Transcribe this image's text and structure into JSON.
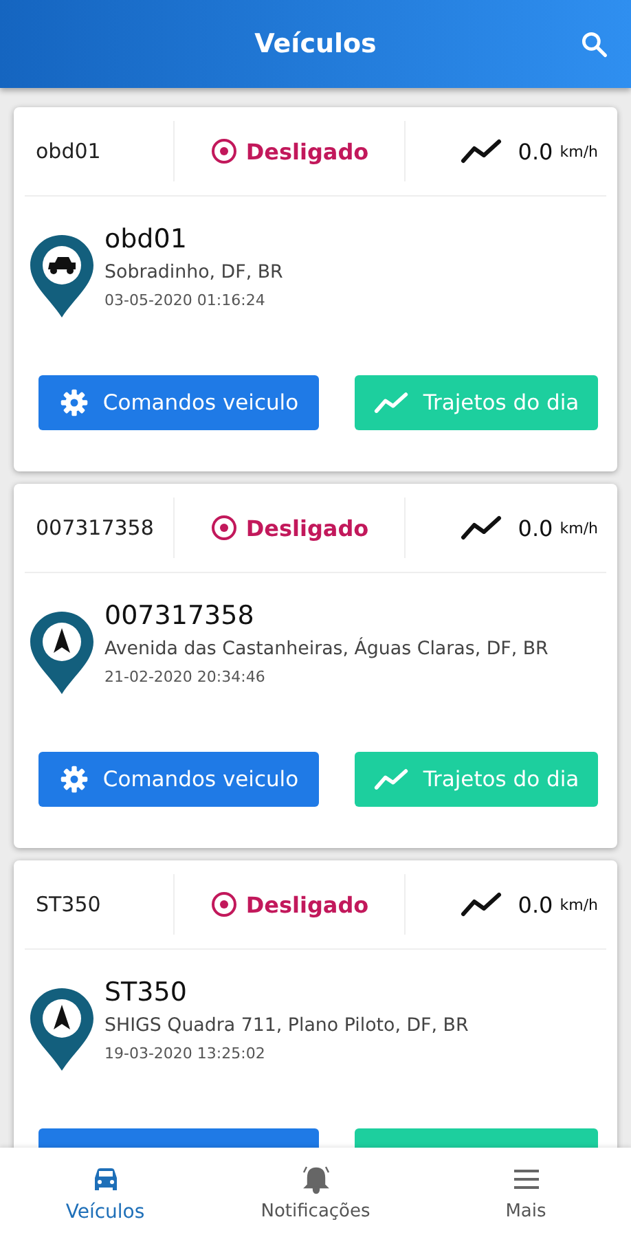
{
  "header": {
    "title": "Veículos"
  },
  "vehicles": [
    {
      "id": "obd01",
      "online": false,
      "status": "Desligado",
      "speed": "0.0",
      "unit": "km/h",
      "kind": "car",
      "name": "obd01",
      "address": "Sobradinho, DF, BR",
      "time": "03-05-2020 01:16:24",
      "buttons": [
        {
          "kind": "commands",
          "label": "Comandos veiculo"
        },
        {
          "kind": "routes",
          "label": "Trajetos do dia"
        }
      ]
    },
    {
      "id": "007317358",
      "online": false,
      "status": "Desligado",
      "speed": "0.0",
      "unit": "km/h",
      "kind": "arrow",
      "name": "007317358",
      "address": "Avenida das Castanheiras, Águas Claras, DF, BR",
      "time": "21-02-2020 20:34:46",
      "buttons": [
        {
          "kind": "commands",
          "label": "Comandos veiculo"
        },
        {
          "kind": "routes",
          "label": "Trajetos do dia"
        }
      ]
    },
    {
      "id": "ST350",
      "online": false,
      "status": "Desligado",
      "speed": "0.0",
      "unit": "km/h",
      "kind": "arrow",
      "name": "ST350",
      "address": "SHIGS Quadra 711, Plano Piloto, DF, BR",
      "time": "19-03-2020 13:25:02",
      "buttons": [
        {
          "kind": "commands"
        },
        {
          "kind": "routes"
        }
      ]
    }
  ],
  "nav": [
    {
      "kind": "car",
      "label": "Veículos",
      "selected": true
    },
    {
      "kind": "bell",
      "label": "Notificações",
      "selected": false
    },
    {
      "kind": "menu",
      "label": "Mais",
      "selected": false
    }
  ]
}
